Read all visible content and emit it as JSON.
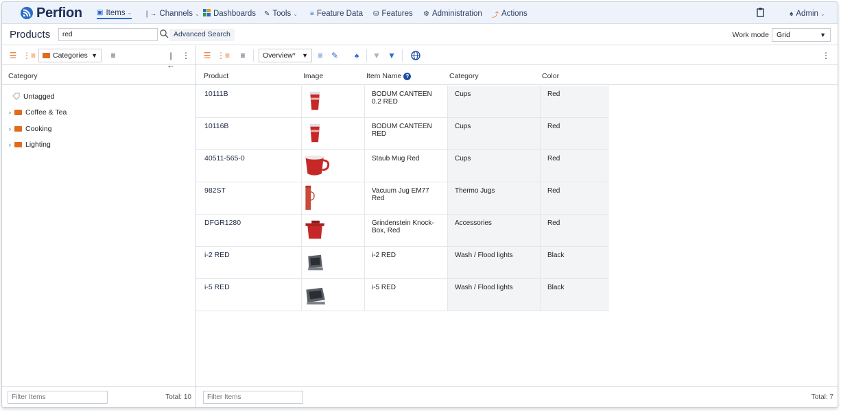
{
  "app": {
    "name": "Perfion"
  },
  "nav": {
    "items": {
      "label": "Items"
    },
    "channels": {
      "label": "Channels"
    },
    "dashboards": {
      "label": "Dashboards"
    },
    "tools": {
      "label": "Tools"
    },
    "feature_data": {
      "label": "Feature Data"
    },
    "features": {
      "label": "Features"
    },
    "administration": {
      "label": "Administration"
    },
    "actions": {
      "label": "Actions"
    },
    "user": {
      "label": "Admin"
    }
  },
  "page": {
    "title": "Products",
    "search_value": "red",
    "advanced_search": "Advanced Search",
    "work_mode_label": "Work mode",
    "work_mode_value": "Grid"
  },
  "left": {
    "categories_dropdown": "Categories",
    "column_header": "Category",
    "tree": [
      {
        "label": "Untagged"
      },
      {
        "label": "Coffee & Tea"
      },
      {
        "label": "Cooking"
      },
      {
        "label": "Lighting"
      }
    ],
    "filter_placeholder": "Filter Items",
    "total": "Total: 10"
  },
  "right": {
    "view_dropdown": "Overview*",
    "columns": {
      "product": "Product",
      "image": "Image",
      "item_name": "Item Name",
      "category": "Category",
      "color": "Color"
    },
    "rows": [
      {
        "product": "10111B",
        "item_name": "BODUM CANTEEN 0.2 RED",
        "category": "Cups",
        "color": "Red"
      },
      {
        "product": "10116B",
        "item_name": "BODUM CANTEEN RED",
        "category": "Cups",
        "color": "Red"
      },
      {
        "product": "40511-565-0",
        "item_name": "Staub Mug Red",
        "category": "Cups",
        "color": "Red"
      },
      {
        "product": "982ST",
        "item_name": "Vacuum Jug EM77 Red",
        "category": "Thermo Jugs",
        "color": "Red"
      },
      {
        "product": "DFGR1280",
        "item_name": "Grindenstein Knock-Box, Red",
        "category": "Accessories",
        "color": "Red"
      },
      {
        "product": "i-2 RED",
        "item_name": "i-2 RED",
        "category": "Wash / Flood lights",
        "color": "Black"
      },
      {
        "product": "i-5 RED",
        "item_name": "i-5 RED",
        "category": "Wash / Flood lights",
        "color": "Black"
      }
    ],
    "filter_placeholder": "Filter Items",
    "total": "Total: 7"
  },
  "colors": {
    "accent": "#2b6cc7",
    "orange": "#e06b1d",
    "product_red": "#c62828",
    "navy": "#1c2f5a"
  }
}
